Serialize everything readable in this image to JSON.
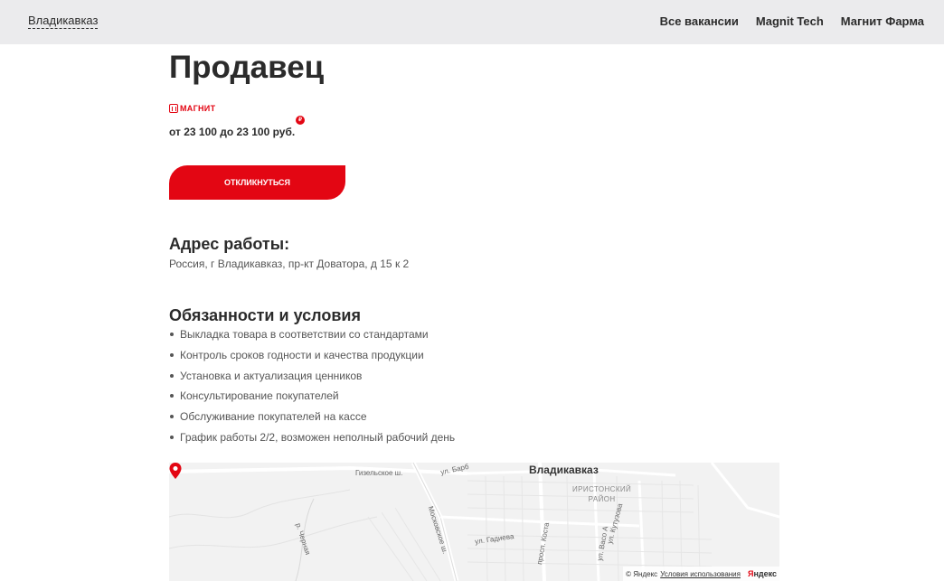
{
  "header": {
    "city": "Владикавказ",
    "nav": [
      "Все вакансии",
      "Magnit Tech",
      "Магнит Фарма"
    ]
  },
  "vacancy": {
    "title": "Продавец",
    "brand": "МАГНИТ",
    "salary": "от 23 100 до 23 100 руб.",
    "ruble_badge": "₽",
    "apply_label": "ОТКЛИКНУТЬСЯ"
  },
  "address": {
    "heading": "Адрес работы:",
    "text": "Россия, г Владикавказ, пр-кт Доватора, д 15 к 2"
  },
  "duties": {
    "heading": "Обязанности и условия",
    "items": [
      "Выкладка товара в соответствии со стандартами",
      "Контроль сроков годности и качества продукции",
      "Установка и актуализация ценников",
      "Консультирование покупателей",
      "Обслуживание покупателей на кассе",
      "График работы 2/2, возможен неполный рабочий день"
    ]
  },
  "map": {
    "city": "Владикавказ",
    "district_line1": "ИРИСТОНСКИЙ",
    "district_line2": "РАЙОН",
    "streets": {
      "gizel": "Гизельское ш.",
      "barb": "ул. Барб",
      "moscow": "Московское ш.",
      "gadieva": "ул. Гадиева",
      "kosta": "просп. Коста",
      "kutuzova": "ул. Кутузова",
      "vaso": "ул. Васо А",
      "chernaya": "р. Черная"
    },
    "copyright": "© Яндекс",
    "terms": "Условия использования",
    "logo_ya": "Я",
    "logo_rest": "ндекс",
    "colors": {
      "pin": "#e30613"
    }
  },
  "colors": {
    "accent": "#e30613",
    "header_bg": "#ebebed",
    "text": "#2b2b2b"
  }
}
